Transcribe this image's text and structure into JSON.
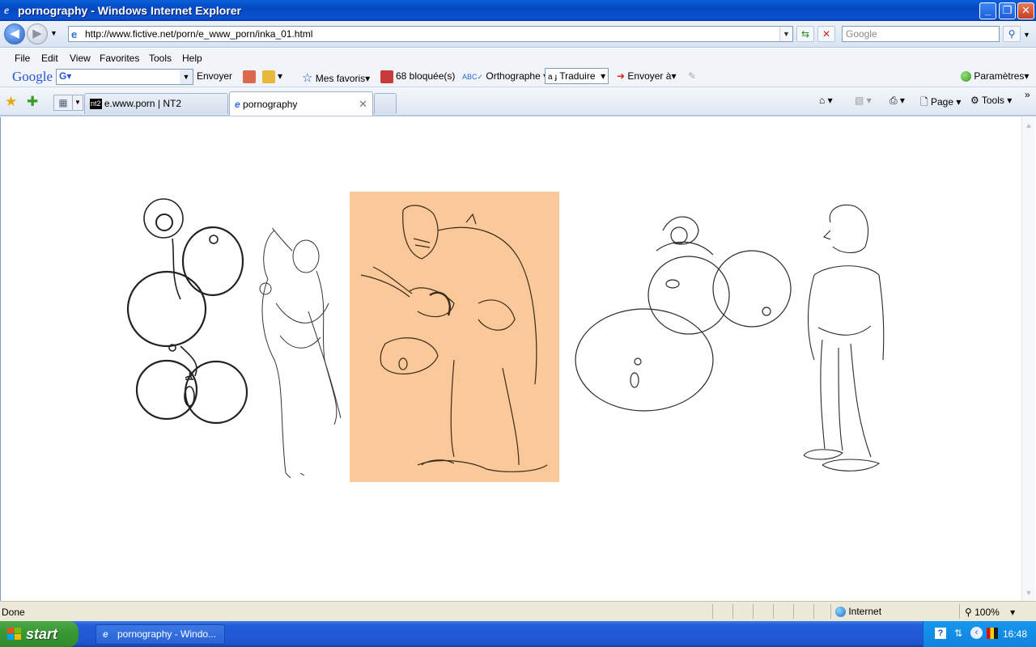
{
  "window": {
    "title": "pornography - Windows Internet Explorer"
  },
  "nav": {
    "address": "http://www.fictive.net/porn/e_www_porn/inka_01.html",
    "search_placeholder": "Google"
  },
  "menu": [
    "File",
    "Edit",
    "View",
    "Favorites",
    "Tools",
    "Help"
  ],
  "google_toolbar": {
    "logo": "Google",
    "send": "Envoyer",
    "favorites": "Mes favoris",
    "blocked": "68 bloquée(s)",
    "spelling": "Orthographe",
    "translate": "Traduire",
    "send_to": "Envoyer à",
    "settings": "Paramètres"
  },
  "tabs": [
    {
      "label": "e.www.porn | NT2",
      "active": false
    },
    {
      "label": "pornography",
      "active": true
    }
  ],
  "command_bar": {
    "page": "Page",
    "tools": "Tools"
  },
  "status": {
    "text": "Done",
    "zone": "Internet",
    "zoom": "100%"
  },
  "taskbar": {
    "start": "start",
    "item": "pornography - Windo...",
    "clock": "16:48"
  },
  "colors": {
    "panel_bg": "#fbc89a",
    "accent": "#0a5fd9"
  }
}
